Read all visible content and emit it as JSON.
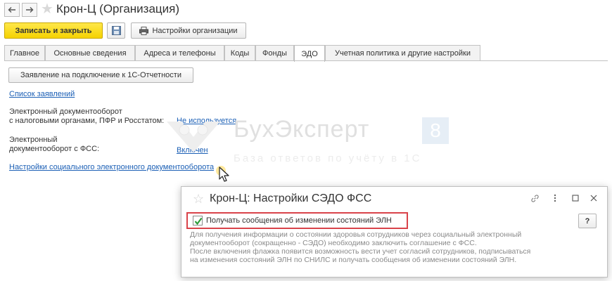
{
  "window": {
    "title": "Крон-Ц (Организация)",
    "icons": [
      "back-arrow-icon",
      "forward-arrow-icon",
      "favorite-star-icon"
    ]
  },
  "toolbar": {
    "save_close_label": "Записать и закрыть",
    "save_icon": "floppy-disk-icon",
    "org_settings_label": "Настройки организации",
    "org_settings_icon": "printer-icon"
  },
  "tabs": [
    {
      "label": "Главное"
    },
    {
      "label": "Основные сведения"
    },
    {
      "label": "Адреса и телефоны"
    },
    {
      "label": "Коды"
    },
    {
      "label": "Фонды"
    },
    {
      "label": "ЭДО",
      "active": true
    },
    {
      "label": "Учетная политика и другие настройки"
    }
  ],
  "edo": {
    "application_button": "Заявление на подключение к 1С-Отчетности",
    "applications_list_link": "Список заявлений",
    "edo_taxes_label_line1": "Электронный документооборот",
    "edo_taxes_label_line2": "с налоговыми органами, ПФР и Росстатом:",
    "edo_taxes_value": "Не используется",
    "edo_fss_label_line1": "Электронный",
    "edo_fss_label_line2": "документооборот с ФСС:",
    "edo_fss_value": "Включен",
    "social_edo_settings_link": "Настройки социального электронного документооборота"
  },
  "watermark": {
    "brand": "БухЭксперт",
    "digit": "8",
    "tagline": "База ответов по учёту в 1С"
  },
  "dialog": {
    "title": "Крон-Ц: Настройки СЭДО ФСС",
    "controls": [
      "link-icon",
      "more-icon",
      "maximize-icon",
      "close-icon"
    ],
    "checkbox_label": "Получать сообщения об изменении состояний ЭЛН",
    "checkbox_checked": true,
    "help_label": "?",
    "hint_lines": [
      "Для получения информации о состоянии здоровья сотрудников через социальный электронный",
      "документооборот (сокращенно - СЭДО) необходимо заключить соглашение с ФСС.",
      "После включения флажка появится возможность вести учет согласий сотрудников, подписываться",
      "на изменения состояний ЭЛН по СНИЛС и получать сообщения об изменении состояний ЭЛН."
    ]
  },
  "colors": {
    "primary_button": "#f5d200",
    "link": "#1b5fb5",
    "highlight_border": "#d9434a",
    "checkmark": "#2e9c3a"
  }
}
